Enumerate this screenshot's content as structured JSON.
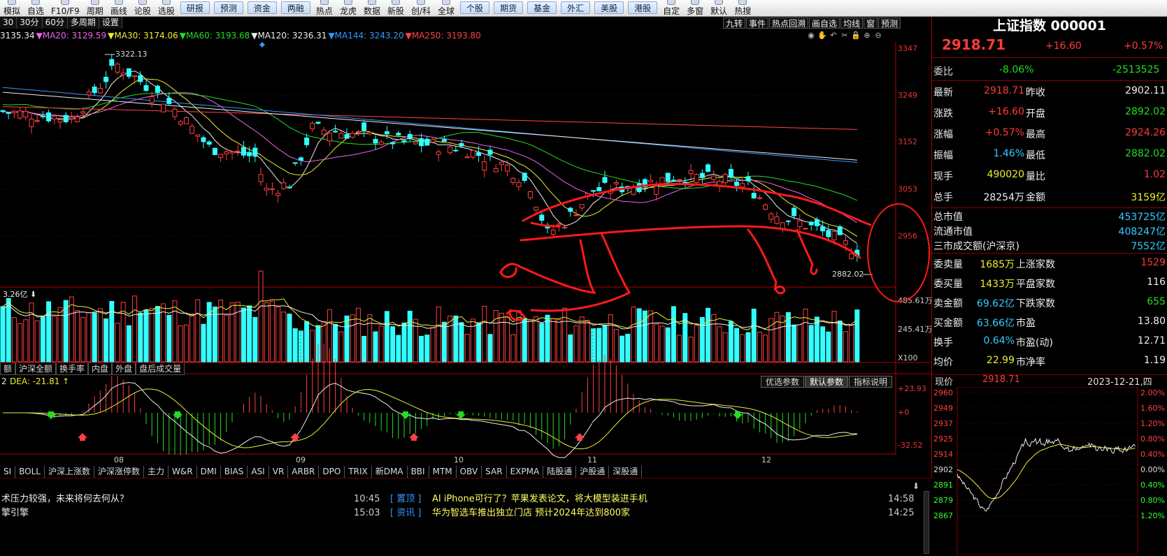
{
  "toolbar": {
    "items": [
      "模拟",
      "自选",
      "F10/F9",
      "周期",
      "画线",
      "论股",
      "选股"
    ],
    "buttons": [
      "研报",
      "预测",
      "资金",
      "两融"
    ],
    "items2": [
      "热点",
      "龙虎",
      "数据",
      "新股",
      "创/科",
      "全球"
    ],
    "buttons2": [
      "个股",
      "期货",
      "基金",
      "外汇",
      "美股",
      "港股"
    ],
    "items3": [
      "自定",
      "多窗",
      "默认",
      "热搜"
    ]
  },
  "chart_tabs": {
    "period_tabs": [
      "30",
      "30分",
      "60分",
      "多周期",
      "设置"
    ],
    "right_tabs": [
      "九转",
      "事件",
      "热点回溯",
      "画自选",
      "均线",
      "窗",
      "预测"
    ]
  },
  "ma_legend": [
    {
      "text": "3135.34",
      "color": "#eeeeee"
    },
    {
      "text": "▼MA20: 3129.59",
      "color": "#ee66ee"
    },
    {
      "text": "▼MA30: 3174.06",
      "color": "#eeee33"
    },
    {
      "text": "▼MA60: 3193.68",
      "color": "#22dd22"
    },
    {
      "text": "▼MA120: 3236.31",
      "color": "#eeeeee"
    },
    {
      "text": "▼MA144: 3243.20",
      "color": "#3399ff"
    },
    {
      "text": "▼MA250: 3193.80",
      "color": "#ff4444"
    }
  ],
  "price_axis": [
    "3347",
    "3249",
    "3152",
    "3053",
    "2956"
  ],
  "annotations": {
    "high": "3322.13",
    "low": "2882.02"
  },
  "volume": {
    "legend": "3.26亿",
    "axis": [
      "485.61万",
      "245.41万",
      "X100"
    ]
  },
  "sub_tabs": [
    "额",
    "沪深全额",
    "换手率",
    "内盘",
    "外盘",
    "盘后成交量"
  ],
  "macd": {
    "legend_val": "2",
    "dea": "DEA: -21.81",
    "axis": [
      "+23.93",
      "+0",
      "-32.52"
    ],
    "param_tabs": [
      "优选参数",
      "默认参数",
      "指标说明"
    ]
  },
  "x_axis": [
    "08",
    "09",
    "10",
    "11",
    "12"
  ],
  "indicator_tabs": [
    "SI",
    "BOLL",
    "沪深上涨数",
    "沪深涨停数",
    "主力",
    "W&R",
    "DMI",
    "BIAS",
    "ASI",
    "VR",
    "ARBR",
    "DPO",
    "TRIX",
    "新DMA",
    "BBI",
    "MTM",
    "OBV",
    "SAR",
    "EXPMA",
    "陆股通",
    "沪股通",
    "深股通"
  ],
  "news": [
    {
      "left": "术压力较强，未来将何去何从？",
      "time": "10:45",
      "cat": "置顶",
      "title": "AI iPhone可行了？苹果发表论文，将大模型装进手机",
      "rtime": "14:58"
    },
    {
      "left": "擎引擎",
      "time": "15:03",
      "cat": "资讯",
      "title": "华为智选车推出独立门店 预计2024年达到800家",
      "rtime": "14:25"
    }
  ],
  "quote": {
    "title": "上证指数 000001",
    "price": "2918.71",
    "change": "+16.60",
    "pct": "+0.57%",
    "weibi": {
      "label": "委比",
      "v1": "-8.06%",
      "v2": "-2513525"
    },
    "rows": [
      {
        "l": "最新",
        "v": "2918.71",
        "vc": "red",
        "r": "昨收",
        "rv": "2902.11",
        "rc": "white"
      },
      {
        "l": "涨跌",
        "v": "+16.60",
        "vc": "red",
        "r": "开盘",
        "rv": "2892.02",
        "rc": "green"
      },
      {
        "l": "涨幅",
        "v": "+0.57%",
        "vc": "red",
        "r": "最高",
        "rv": "2924.26",
        "rc": "red"
      },
      {
        "l": "振幅",
        "v": "1.46%",
        "vc": "cyan",
        "r": "最低",
        "rv": "2882.02",
        "rc": "green"
      },
      {
        "l": "现手",
        "v": "490020",
        "vc": "yellow",
        "r": "量比",
        "rv": "1.02",
        "rc": "red"
      },
      {
        "l": "总手",
        "v": "28254万",
        "vc": "white",
        "r": "金额",
        "rv": "3159亿",
        "rc": "yellow"
      }
    ],
    "rows2": [
      {
        "l": "总市值",
        "v": "453725亿"
      },
      {
        "l": "流通市值",
        "v": "408247亿"
      },
      {
        "l": "三市成交额(沪深京)",
        "v": "7552亿"
      }
    ],
    "rows3": [
      {
        "l": "委卖量",
        "v": "1685万",
        "vc": "yellow",
        "r": "上涨家数",
        "rv": "1529",
        "rc": "red"
      },
      {
        "l": "委买量",
        "v": "1433万",
        "vc": "yellow",
        "r": "平盘家数",
        "rv": "116",
        "rc": "white"
      },
      {
        "l": "卖金额",
        "v": "69.62亿",
        "vc": "cyan",
        "r": "下跌家数",
        "rv": "655",
        "rc": "green"
      },
      {
        "l": "买金额",
        "v": "63.66亿",
        "vc": "cyan",
        "r": "市盈",
        "rv": "13.80",
        "rc": "white"
      },
      {
        "l": "换手",
        "v": "0.64%",
        "vc": "cyan",
        "r": "市盈(动)",
        "rv": "12.71",
        "rc": "white"
      },
      {
        "l": "均价",
        "v": "22.99",
        "vc": "yellow",
        "r": "市净率",
        "rv": "1.19",
        "rc": "white"
      }
    ],
    "mini": {
      "label": "现价",
      "price": "2918.71",
      "date": "2023-12-21,四",
      "y_left": [
        "2960",
        "2949",
        "2937",
        "2925",
        "2914",
        "2902",
        "2891",
        "2879",
        "2867"
      ],
      "y_right": [
        "2.00%",
        "1.60%",
        "1.20%",
        "0.80%",
        "0.40%",
        "0.00%",
        "0.40%",
        "0.80%",
        "1.20%"
      ]
    }
  }
}
